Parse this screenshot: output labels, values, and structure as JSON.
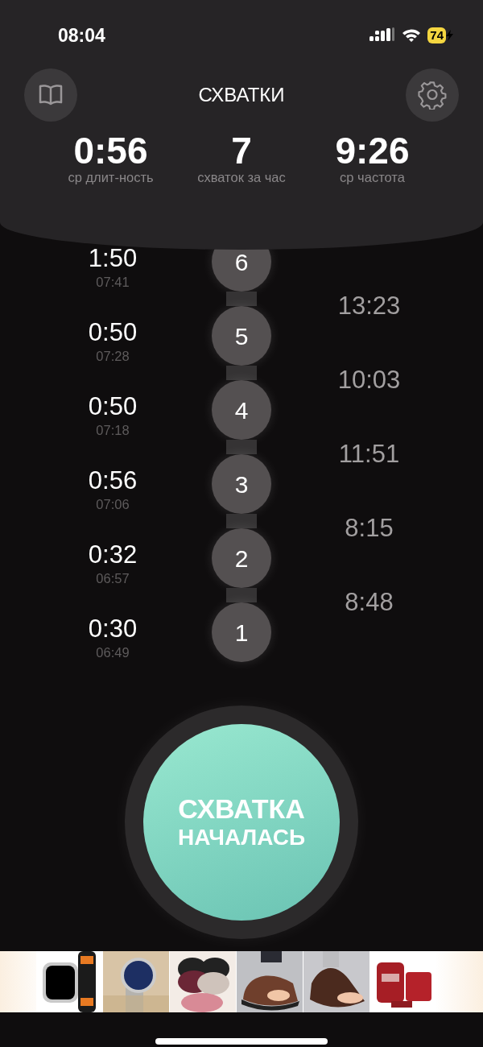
{
  "status_bar": {
    "time": "08:04",
    "battery": "74"
  },
  "header": {
    "title": "СХВАТКИ"
  },
  "stats": [
    {
      "value": "0:56",
      "label": "ср длит-ность"
    },
    {
      "value": "7",
      "label": "схваток за час"
    },
    {
      "value": "9:26",
      "label": "ср частота"
    }
  ],
  "contractions": [
    {
      "number": "6",
      "duration": "1:50",
      "start": "07:41",
      "interval": "13:23"
    },
    {
      "number": "5",
      "duration": "0:50",
      "start": "07:28",
      "interval": "10:03"
    },
    {
      "number": "4",
      "duration": "0:50",
      "start": "07:18",
      "interval": "11:51"
    },
    {
      "number": "3",
      "duration": "0:56",
      "start": "07:06",
      "interval": "8:15"
    },
    {
      "number": "2",
      "duration": "0:32",
      "start": "06:57",
      "interval": "8:48"
    },
    {
      "number": "1",
      "duration": "0:30",
      "start": "06:49"
    }
  ],
  "main_button": {
    "line_1": "СХВАТКА",
    "line_2": "НАЧАЛАСЬ"
  }
}
